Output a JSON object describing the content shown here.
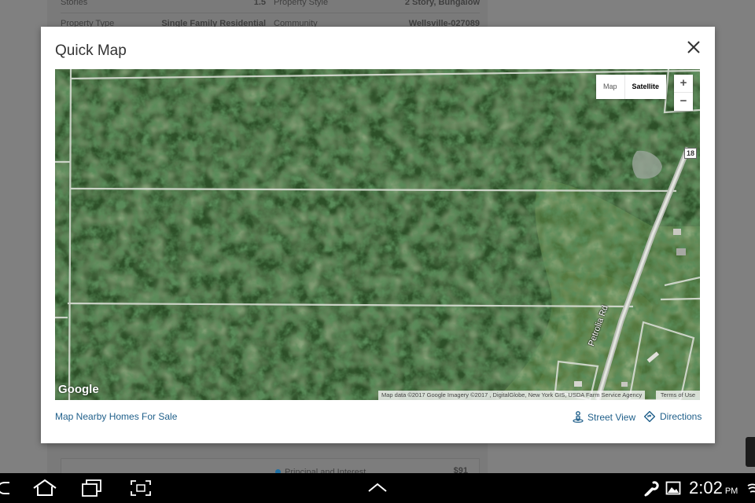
{
  "background": {
    "rows": [
      {
        "label": "Stories",
        "value": "1.5",
        "label2": "Property Style",
        "value2": "2 Story, Bungalow"
      },
      {
        "label": "Property Type",
        "value": "Single Family Residential",
        "label2": "Community",
        "value2": "Wellsville-027089"
      }
    ],
    "bottom_legend": "Principal and Interest",
    "bottom_amount": "$91"
  },
  "modal": {
    "title": "Quick Map",
    "close_icon": "close-icon"
  },
  "map": {
    "type_map_label": "Map",
    "type_satellite_label": "Satellite",
    "zoom_in_label": "+",
    "zoom_out_label": "−",
    "road_label": "Petrolia Rd",
    "route_number": "18",
    "google_logo": "Google",
    "attribution": "Map data ©2017 Google Imagery ©2017 , DigitalGlobe, New York GIS, USDA Farm Service Agency",
    "terms": "Terms of Use"
  },
  "links": {
    "nearby": "Map Nearby Homes For Sale",
    "street_view": "Street View",
    "directions": "Directions"
  },
  "statusbar": {
    "time": "2:02",
    "ampm": "PM"
  },
  "colors": {
    "link": "#1f5f8a",
    "forest": "#2c4f27",
    "modal_bg": "#ffffff",
    "nav_bg": "#000000"
  }
}
